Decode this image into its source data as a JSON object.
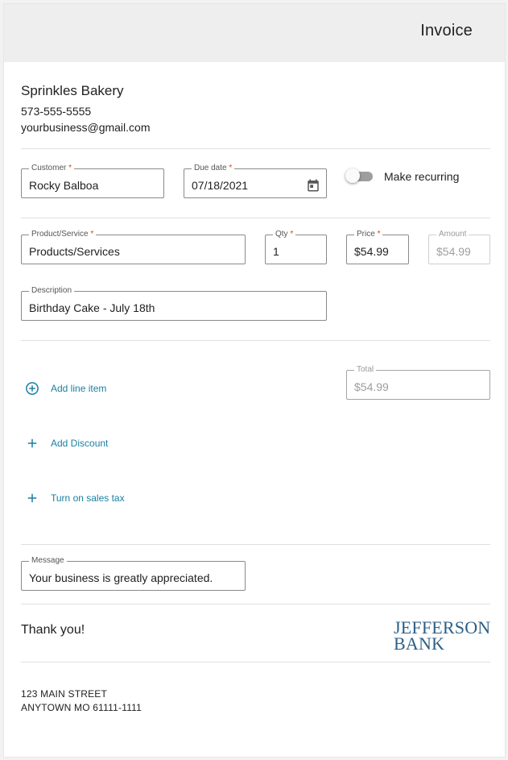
{
  "header": {
    "title": "Invoice"
  },
  "business": {
    "name": "Sprinkles Bakery",
    "phone": "573-555-5555",
    "email": "yourbusiness@gmail.com"
  },
  "customer": {
    "label": "Customer",
    "required_mark": "*",
    "value": "Rocky Balboa"
  },
  "due_date": {
    "label": "Due date",
    "required_mark": "*",
    "value": "07/18/2021",
    "icon": "calendar-icon"
  },
  "recurring": {
    "label": "Make recurring",
    "enabled": false
  },
  "line_item": {
    "product": {
      "label": "Product/Service",
      "required_mark": "*",
      "value": "Products/Services"
    },
    "qty": {
      "label": "Qty",
      "required_mark": "*",
      "value": "1"
    },
    "price": {
      "label": "Price",
      "required_mark": "*",
      "value": "$54.99"
    },
    "amount": {
      "label": "Amount",
      "value": "$54.99"
    },
    "description": {
      "label": "Description",
      "value": "Birthday Cake - July 18th"
    }
  },
  "total": {
    "label": "Total",
    "value": "$54.99"
  },
  "actions": {
    "add_line_item": {
      "label": "Add line item",
      "icon": "plus-circle-icon"
    },
    "add_discount": {
      "label": "Add Discount",
      "icon": "plus-icon"
    },
    "sales_tax": {
      "label": "Turn on sales tax",
      "icon": "plus-icon"
    }
  },
  "message": {
    "label": "Message",
    "value": "Your business is greatly appreciated."
  },
  "footer": {
    "thanks": "Thank you!",
    "logo_line1": "JEFFERSON",
    "logo_line2": "BANK",
    "address_line1": "123 MAIN STREET",
    "address_line2": "ANYTOWN MO 61111-1111"
  },
  "colors": {
    "accent": "#1a7fa3",
    "required": "#d84315",
    "logo": "#2c5f87",
    "header_bg": "#eeeeee"
  }
}
